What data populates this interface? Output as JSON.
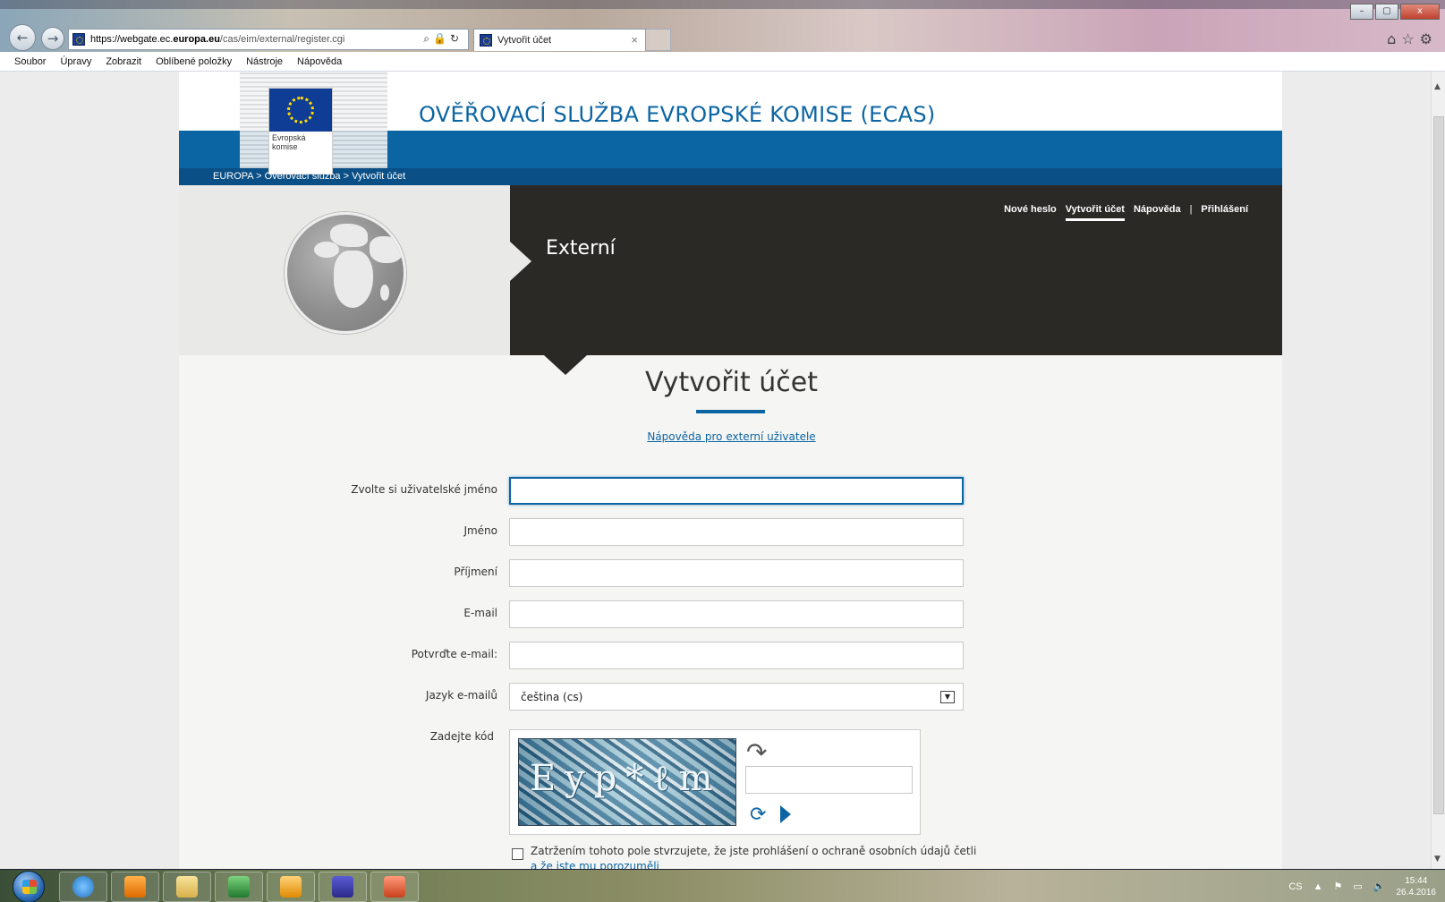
{
  "browser": {
    "url_prefix": "https://webgate.ec.",
    "url_domain": "europa.eu",
    "url_path": "/cas/eim/external/register.cgi",
    "tab_title": "Vytvořit účet",
    "tab_close": "×",
    "menu": [
      "Soubor",
      "Úpravy",
      "Zobrazit",
      "Oblíbené položky",
      "Nástroje",
      "Nápověda"
    ],
    "window_controls": [
      "–",
      "▢",
      "x"
    ]
  },
  "header": {
    "logo_text": "Evropská\nkomise",
    "site_title": "OVĚŘOVACÍ SLUŽBA EVROPSKÉ KOMISE (ECAS)",
    "breadcrumb": "EUROPA > Ověřovací služba > Vytvořit účet"
  },
  "topnav": {
    "items": [
      "Nové heslo",
      "Vytvořit účet",
      "Nápověda"
    ],
    "separator": "|",
    "login": "Přihlášení",
    "active_index": 1
  },
  "hero": {
    "title": "Externí"
  },
  "form": {
    "title": "Vytvořit účet",
    "help_link": "Nápověda pro externí uživatele",
    "fields": [
      {
        "label": "Zvolte si uživatelské jméno",
        "value": ""
      },
      {
        "label": "Jméno",
        "value": ""
      },
      {
        "label": "Příjmení",
        "value": ""
      },
      {
        "label": "E-mail",
        "value": ""
      },
      {
        "label": "Potvrďte e-mail:",
        "value": ""
      }
    ],
    "language_label": "Jazyk e-mailů",
    "language_value": "čeština (cs)",
    "captcha_label": "Zadejte kód",
    "captcha_chars": "Eyp*ℓm",
    "privacy_text": "Zatržením tohoto pole stvrzujete, že jste prohlášení o ochraně osobních údajů četli ",
    "privacy_link": "a že jste mu porozuměli",
    "privacy_checked": false
  },
  "taskbar": {
    "language": "CS",
    "time": "15:44",
    "date": "26.4.2016"
  },
  "colors": {
    "ec_blue": "#0c65a3",
    "ec_dark_blue": "#0a4f86",
    "hero_dark": "#2b2926",
    "eu_flag": "#0f3c94",
    "eu_star": "#ffdd00"
  }
}
